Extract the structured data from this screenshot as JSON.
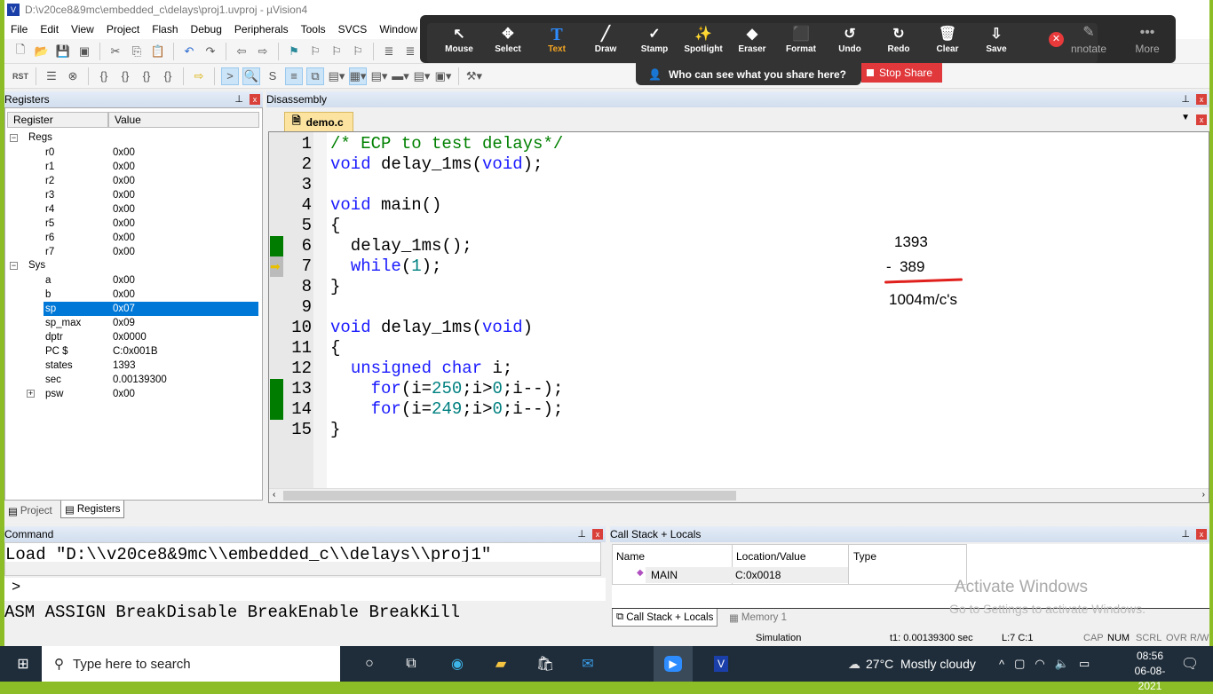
{
  "window": {
    "title": "D:\\v20ce8&9mc\\embedded_c\\delays\\proj1.uvproj - µVision4"
  },
  "menu": [
    "File",
    "Edit",
    "View",
    "Project",
    "Flash",
    "Debug",
    "Peripherals",
    "Tools",
    "SVCS",
    "Window"
  ],
  "registers": {
    "title": "Registers",
    "col_register": "Register",
    "col_value": "Value",
    "groups": [
      {
        "name": "Regs",
        "items": [
          [
            "r0",
            "0x00"
          ],
          [
            "r1",
            "0x00"
          ],
          [
            "r2",
            "0x00"
          ],
          [
            "r3",
            "0x00"
          ],
          [
            "r4",
            "0x00"
          ],
          [
            "r5",
            "0x00"
          ],
          [
            "r6",
            "0x00"
          ],
          [
            "r7",
            "0x00"
          ]
        ]
      },
      {
        "name": "Sys",
        "items": [
          [
            "a",
            "0x00"
          ],
          [
            "b",
            "0x00"
          ],
          [
            "sp",
            "0x07"
          ],
          [
            "sp_max",
            "0x09"
          ],
          [
            "dptr",
            "0x0000"
          ],
          [
            "PC  $",
            "C:0x001B"
          ],
          [
            "states",
            "1393"
          ],
          [
            "sec",
            "0.00139300"
          ],
          [
            "psw",
            "0x00"
          ]
        ]
      }
    ],
    "selected": "sp",
    "tabs": [
      "Project",
      "Registers"
    ]
  },
  "disassembly": {
    "title": "Disassembly",
    "file_tab": "demo.c",
    "lines": [
      [
        [
          "/* ECP to test delays*/",
          "c"
        ]
      ],
      [
        [
          "void",
          "k"
        ],
        [
          " delay_1ms(",
          "p"
        ],
        [
          "void",
          "k"
        ],
        [
          ");",
          "p"
        ]
      ],
      [],
      [
        [
          "void",
          "k"
        ],
        [
          " main()",
          "p"
        ]
      ],
      [
        [
          "{",
          "p"
        ]
      ],
      [
        [
          "  delay_1ms();",
          "p"
        ]
      ],
      [
        [
          "  ",
          "p"
        ],
        [
          "while",
          "k"
        ],
        [
          "(",
          "p"
        ],
        [
          "1",
          "n"
        ],
        [
          ");",
          "p"
        ]
      ],
      [
        [
          "}",
          "p"
        ]
      ],
      [],
      [
        [
          "void",
          "k"
        ],
        [
          " delay_1ms(",
          "p"
        ],
        [
          "void",
          "k"
        ],
        [
          ")",
          "p"
        ]
      ],
      [
        [
          "{",
          "p"
        ]
      ],
      [
        [
          "  ",
          "p"
        ],
        [
          "unsigned",
          "k"
        ],
        [
          " ",
          "p"
        ],
        [
          "char",
          "k"
        ],
        [
          " i;",
          "p"
        ]
      ],
      [
        [
          "    ",
          "p"
        ],
        [
          "for",
          "k"
        ],
        [
          "(i=",
          "p"
        ],
        [
          "250",
          "n"
        ],
        [
          ";i>",
          "p"
        ],
        [
          "0",
          "n"
        ],
        [
          ";i--);",
          "p"
        ]
      ],
      [
        [
          "    ",
          "p"
        ],
        [
          "for",
          "k"
        ],
        [
          "(i=",
          "p"
        ],
        [
          "249",
          "n"
        ],
        [
          ";i>",
          "p"
        ],
        [
          "0",
          "n"
        ],
        [
          ";i--);",
          "p"
        ]
      ],
      [
        [
          "}",
          "p"
        ]
      ]
    ],
    "executed_lines": [
      6,
      13,
      14
    ],
    "current_line": 7,
    "fold_lines": [
      5,
      11
    ]
  },
  "annotation": {
    "line1": "1393",
    "line2": "-  389",
    "result": "1004m/c's"
  },
  "zoom_toolbar": {
    "tools": [
      "Mouse",
      "Select",
      "Text",
      "Draw",
      "Stamp",
      "Spotlight",
      "Eraser",
      "Format",
      "Undo",
      "Redo",
      "Clear",
      "Save"
    ],
    "extra": [
      "nnotate",
      "More"
    ],
    "who_can_see": "Who can see what you share here?",
    "stop_share": "Stop Share"
  },
  "command": {
    "title": "Command",
    "output": "Load \"D:\\\\v20ce8&9mc\\\\embedded_c\\\\delays\\\\proj1\"",
    "prompt": ">",
    "hints": "ASM ASSIGN BreakDisable BreakEnable BreakKill"
  },
  "callstack": {
    "title": "Call Stack + Locals",
    "cols": [
      "Name",
      "Location/Value",
      "Type"
    ],
    "row": {
      "name": "MAIN",
      "value": "C:0x0018"
    },
    "tabs": [
      "Call Stack + Locals",
      "Memory 1"
    ]
  },
  "watermark": {
    "title": "Activate Windows",
    "sub": "Go to Settings to activate Windows."
  },
  "status": {
    "mode": "Simulation",
    "t1": "t1: 0.00139300 sec",
    "pos": "L:7 C:1",
    "keys": [
      "CAP",
      "NUM",
      "SCRL",
      "OVR",
      "R/W"
    ]
  },
  "taskbar": {
    "search": "Type here to search",
    "weather": "27°C  Mostly cloudy",
    "time": "08:56",
    "date": "06-08-2021"
  }
}
